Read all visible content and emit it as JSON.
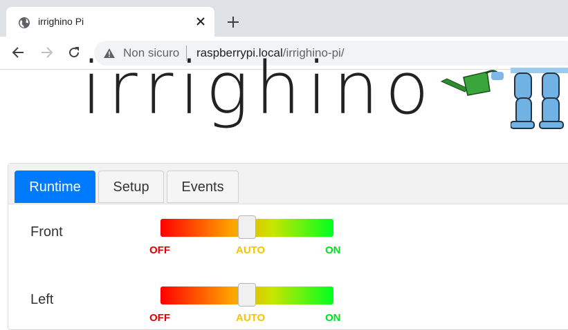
{
  "browser": {
    "tab_title": "irrighino Pi",
    "security_label": "Non sicuro",
    "url_host": "raspberrypi.local",
    "url_path": "/irrighino-pi/"
  },
  "page": {
    "logo_text": "irrighino",
    "tabs": [
      {
        "label": "Runtime",
        "active": true
      },
      {
        "label": "Setup",
        "active": false
      },
      {
        "label": "Events",
        "active": false
      }
    ],
    "zones": [
      {
        "name": "Front",
        "mode": "AUTO",
        "position": 0.5
      },
      {
        "name": "Left",
        "mode": "AUTO",
        "position": 0.5
      }
    ],
    "mode_labels": {
      "off": "OFF",
      "auto": "AUTO",
      "on": "ON"
    }
  },
  "colors": {
    "accent": "#007bff",
    "off": "#e00000",
    "auto": "#f5c400",
    "on": "#00e020"
  }
}
